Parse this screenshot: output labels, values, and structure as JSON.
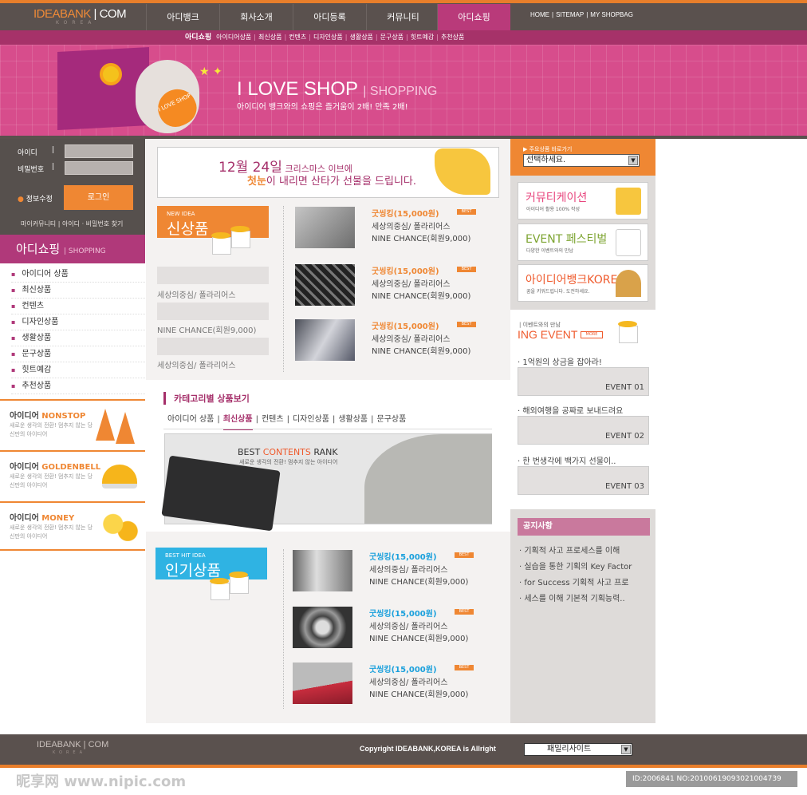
{
  "header": {
    "logo_main": "IDEABANK",
    "logo_sep": " | ",
    "logo_com": "COM",
    "logo_sub": "KOREA",
    "nav": [
      "아디뱅크",
      "회사소개",
      "아디등록",
      "커뮤니티",
      "아디쇼핑"
    ],
    "util": [
      "HOME",
      "SITEMAP",
      "MY SHOPBAG"
    ]
  },
  "subnav": {
    "current": "아디쇼핑",
    "items": [
      "아이디어상품",
      "최신상품",
      "컨텐츠",
      "디자인상품",
      "생활상품",
      "문구상품",
      "힛트예감",
      "추천상품"
    ]
  },
  "banner": {
    "title": "I LOVE SHOP",
    "title_sub": "| SHOPPING",
    "subtitle": "아이디어 뱅크와의 쇼핑은 즐거움이 2배! 만족 2배!",
    "heart_text": "I LOVE SHOP"
  },
  "login": {
    "id_label": "아이디",
    "pw_label": "비밀번호",
    "id_value": "",
    "pw_value": "",
    "pw_find": "정보수정",
    "button": "로그인",
    "links": "마이커뮤니티 | 아이디 · 비밀번호 찾기"
  },
  "leftmenu": {
    "title": "아디쇼핑",
    "title_sub": "| SHOPPING",
    "items": [
      "아이디어 상품",
      "최신상품",
      "컨텐츠",
      "디자인상품",
      "생활상품",
      "문구상품",
      "힛트예감",
      "추천상품"
    ]
  },
  "promos": [
    {
      "pre": "아이디어 ",
      "hi": "NONSTOP",
      "desc": "새로운 생각의 전환! 멈추지 않는 당신만의 아이디어"
    },
    {
      "pre": "아이디어 ",
      "hi": "GOLDENBELL",
      "desc": "새로운 생각의 전환! 멈추지 않는 당신만의 아이디어"
    },
    {
      "pre": "아이디어 ",
      "hi": "MONEY",
      "desc": "새로운 생각의 전환! 멈추지 않는 당신만의 아이디어"
    }
  ],
  "xmas": {
    "date": "12월 24일",
    "line1": " 크리스마스 이브에",
    "first": "첫눈",
    "line2": "이 내리면 산타가 선물을 드립니다."
  },
  "new_section": {
    "en": "NEW IDEA",
    "ko": "신상품",
    "side": [
      "세상의중심/ 폴라리어스",
      "NINE CHANCE(회원9,000)",
      "세상의중심/ 폴라리어스"
    ]
  },
  "products_new": [
    {
      "price": "굿씽킹(15,000원)",
      "best": "BEST",
      "name": "세상의중심/ 폴라리어스",
      "note": "NINE CHANCE(회원9,000)"
    },
    {
      "price": "굿씽킹(15,000원)",
      "best": "BEST",
      "name": "세상의중심/ 폴라리어스",
      "note": "NINE CHANCE(회원9,000)"
    },
    {
      "price": "굿씽킹(15,000원)",
      "best": "BEST",
      "name": "세상의중심/ 폴라리어스",
      "note": "NINE CHANCE(회원9,000)"
    }
  ],
  "category": {
    "title": "카테고리별 상품보기",
    "tabs": [
      "아이디어 상품",
      "최신상품",
      "컨텐츠",
      "디자인상품",
      "생활상품",
      "문구상품"
    ],
    "active": "최신상품",
    "banner_pre": "BEST ",
    "banner_hi": "CONTENTS",
    "banner_post": " RANK",
    "banner_sub": "새로운 생각의 전환! 멈추지 않는 아이디어"
  },
  "hit_section": {
    "en": "BEST HIT IDEA",
    "ko": "인기상품"
  },
  "products_hit": [
    {
      "price": "굿씽킹(15,000원)",
      "best": "BEST",
      "name": "세상의중심/ 폴라리어스",
      "note": "NINE CHANCE(회원9,000)"
    },
    {
      "price": "굿씽킹(15,000원)",
      "best": "BEST",
      "name": "세상의중심/ 폴라리어스",
      "note": "NINE CHANCE(회원9,000)"
    },
    {
      "price": "굿씽킹(15,000원)",
      "best": "BEST",
      "name": "세상의중심/ 폴라리어스",
      "note": "NINE CHANCE(회원9,000)"
    }
  ],
  "quick": {
    "label": "▶ 주요상품 바로가기",
    "select": "선택하세요."
  },
  "right_banners": [
    {
      "title": "커뮤티케이션",
      "sub": "아이디어 활용 100% 작성"
    },
    {
      "title": "EVENT 페스티벌",
      "sub": "다양한 이벤트와의 만남"
    },
    {
      "title": "아이디어뱅크KOREA",
      "sub": "꿈을 키워드립니다. 도전하세요."
    }
  ],
  "events": {
    "sub": "이벤트와의 만남",
    "title": "ING EVENT",
    "more": "MORE",
    "items": [
      {
        "q": "· 1억원의 상금을 잡아라!",
        "label": "EVENT 01"
      },
      {
        "q": "· 해외여행을 공짜로 보내드려요",
        "label": "EVENT 02"
      },
      {
        "q": "· 한 번생각에 백가지 선물이..",
        "label": "EVENT 03"
      }
    ]
  },
  "notice": {
    "title": "공지사항",
    "items": [
      "· 기획적 사고 프로세스를 이해",
      "· 실습을 통한 기획의 Key Factor",
      "· for Success 기획적 사고 프로",
      "· 세스를 이해 기본적 기획능력.."
    ]
  },
  "footer": {
    "logo": "IDEABANK | COM",
    "logo_sub": "KOREA",
    "copyright": "Copyright IDEABANK,KOREA is Allright",
    "family": "패밀리사이트"
  },
  "watermark": {
    "left": "昵享网 www.nipic.com",
    "right": "ID:2006841 NO:20100619093021004739"
  },
  "colors": {
    "brand_magenta": "#b93a7a",
    "brand_orange": "#ef8733",
    "dark": "#5a514e"
  }
}
